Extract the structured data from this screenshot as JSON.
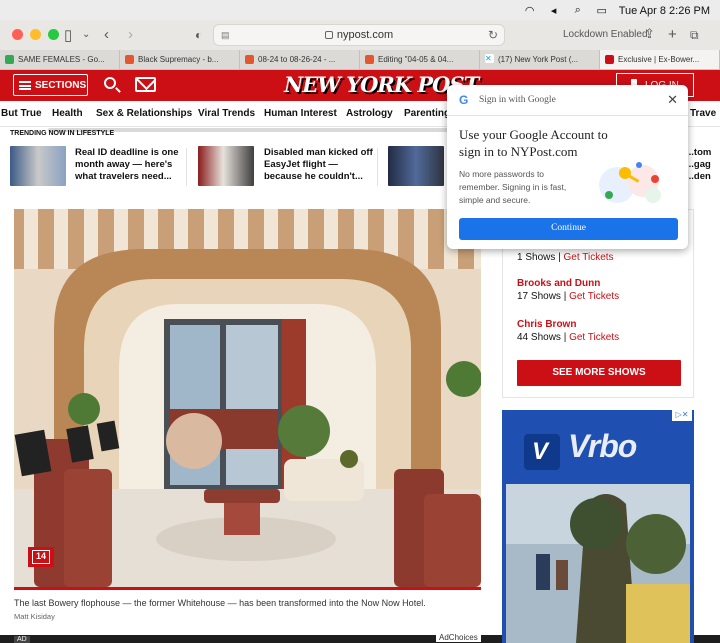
{
  "system": {
    "menubar_datetime": "Tue Apr 8  2:26 PM"
  },
  "browser": {
    "url": "nypost.com",
    "lockdown_label": "Lockdown Enabled",
    "tabs": [
      {
        "label": "SAME FEMALES - Go...",
        "favicon_color": "#34a853"
      },
      {
        "label": "Black Supremacy - b...",
        "favicon_color": "#e4572e"
      },
      {
        "label": "08-24 to 08-26-24 - ...",
        "favicon_color": "#e4572e"
      },
      {
        "label": "Editing \"04-05 & 04...",
        "favicon_color": "#e4572e"
      },
      {
        "label": "(17) New York Post (...",
        "favicon_color": "#1d9bf0"
      },
      {
        "label": "Exclusive | Ex-Bower...",
        "favicon_color": "#cb0f15"
      }
    ]
  },
  "site": {
    "brand_color": "#cb0f15",
    "logo_text": "NEW YORK POST",
    "sections_label": "SECTIONS",
    "login_label": "LOG IN",
    "nav": [
      "But True",
      "Health",
      "Sex & Relationships",
      "Viral Trends",
      "Human Interest",
      "Astrology",
      "Parenting",
      "Trave"
    ],
    "trending_label": "TRENDING NOW IN LIFESTYLE",
    "trending": [
      {
        "title": "Real ID deadline is one month away — here's what travelers need..."
      },
      {
        "title": "Disabled man kicked off EasyJet flight — because he couldn't..."
      },
      {
        "title": "...tom\n...gag\n...den"
      }
    ]
  },
  "article": {
    "gallery_count": "14",
    "caption": "The last Bowery flophouse — the former Whitehouse — has been transformed into the Now Now Hotel.",
    "credit": "Matt Kisiday"
  },
  "sidebar": {
    "shows": [
      {
        "name": "",
        "count": "1 Shows",
        "link": "Get Tickets"
      },
      {
        "name": "Brooks and Dunn",
        "count": "17 Shows",
        "link": "Get Tickets"
      },
      {
        "name": "Chris Brown",
        "count": "44 Shows",
        "link": "Get Tickets"
      }
    ],
    "more_button": "SEE MORE SHOWS",
    "separator": "|"
  },
  "ad": {
    "brand": "Vrbo",
    "adchoices": "AdChoices",
    "ad_label": "AD"
  },
  "google_popup": {
    "header": "Sign in with Google",
    "title": "Use your Google Account to sign in to NYPost.com",
    "subtitle": "No more passwords to remember. Signing in is fast, simple and secure.",
    "button": "Continue",
    "button_color": "#1a73e8"
  }
}
